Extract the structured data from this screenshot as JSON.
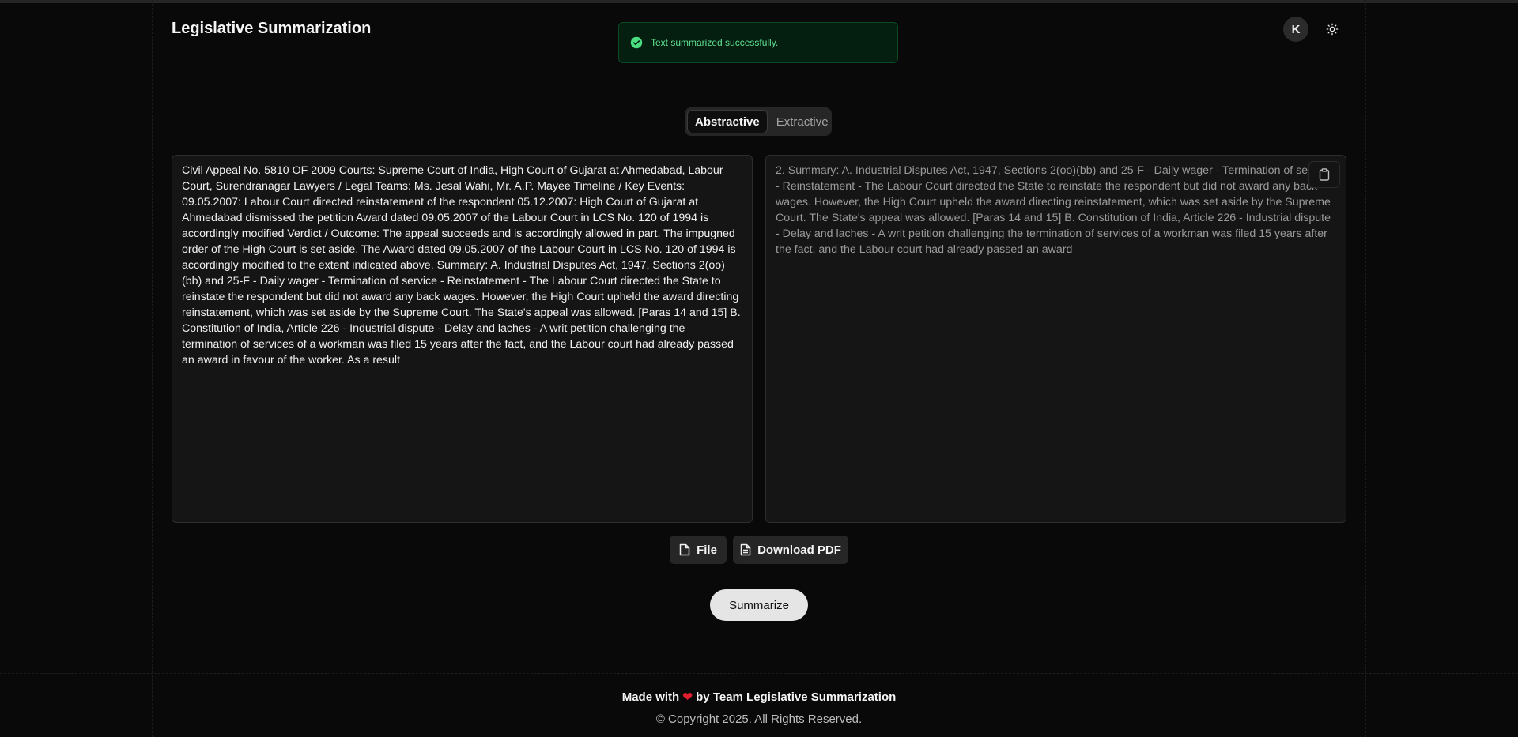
{
  "header": {
    "title": "Legislative Summarization",
    "avatar_initial": "K"
  },
  "toast": {
    "message": "Text summarized successfully."
  },
  "mode_tabs": {
    "items": [
      "Abstractive",
      "Extractive"
    ],
    "selected": "Abstractive"
  },
  "input_panel": {
    "text": "Civil Appeal No. 5810 OF 2009  Courts:  Supreme Court of India, High Court of Gujarat at Ahmedabad, Labour Court, Surendranagar  Lawyers / Legal Teams:  Ms. Jesal Wahi, Mr. A.P. Mayee  Timeline / Key Events:  09.05.2007: Labour Court directed reinstatement of the respondent  05.12.2007: High Court of Gujarat at Ahmedabad dismissed the petition  Award dated 09.05.2007 of the Labour Court in LCS No. 120 of 1994 is accordingly  modified  Verdict / Outcome:  The appeal succeeds and is accordingly allowed in part. The impugned order of the High  Court is set aside. The Award dated 09.05.2007 of the Labour Court in LCS No. 120 of 1994  is accordingly modified to the extent indicated above.  Summary:  A. Industrial Disputes Act, 1947, Sections 2(oo)(bb) and 25-F - Daily wager - Termination of  service - Reinstatement - The Labour Court directed the State to reinstate the respondent  but did not award any back wages. However, the High Court upheld the award directing  reinstatement, which was set aside by the Supreme Court. The State's appeal was allowed.  [Paras 14 and 15]  B. Constitution of India, Article 226 - Industrial dispute - Delay and laches - A writ petition  challenging the termination of services of a workman was filed 15 years after the fact, and  the Labour court had already passed an award in favour of the worker. As a result"
  },
  "output_panel": {
    "text": "2. Summary:  A. Industrial Disputes Act, 1947, Sections 2(oo)(bb) and 25-F - Daily wager - Termination of service - Reinstatement - The Labour Court directed the State to reinstate the respondent  but did not award any back wages. However, the High Court upheld the award directing  reinstatement, which was set aside by the Supreme Court. The State's appeal was allowed.  [Paras 14 and 15]  B. Constitution of India, Article 226 - Industrial dispute - Delay and laches - A writ petition  challenging the termination of services of a workman was filed 15 years after the fact, and  the Labour court had already passed an award"
  },
  "actions": {
    "file_label": "File",
    "download_label": "Download PDF",
    "summarize_label": "Summarize"
  },
  "footer": {
    "made_with_prefix": "Made with",
    "heart": "❤",
    "made_with_suffix": "by Team Legislative Summarization",
    "copyright": "© Copyright 2025. All Rights Reserved."
  },
  "colors": {
    "background": "#090909",
    "panel": "#151515",
    "toast_bg": "#041f10",
    "toast_text": "#5fe08f",
    "heart": "#e11d2e"
  }
}
